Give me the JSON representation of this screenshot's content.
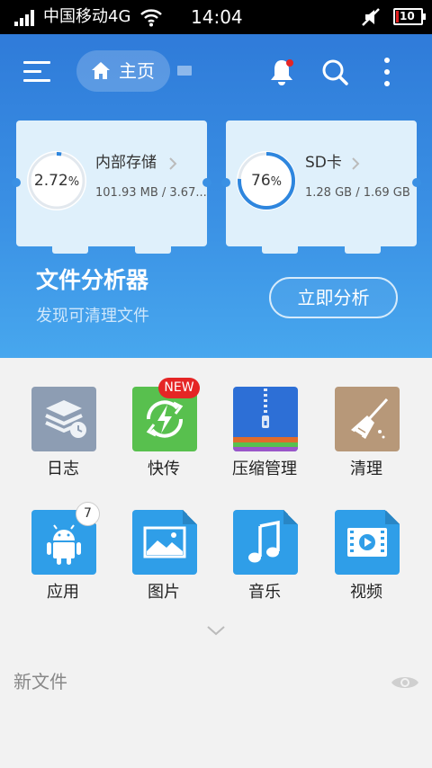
{
  "status_bar": {
    "carrier": "中国移动4G",
    "time": "14:04",
    "battery": "10"
  },
  "header": {
    "home_label": "主页",
    "internal_storage": {
      "percent_value": "2.72",
      "percent_sign": "%",
      "fraction": 0.0272,
      "name": "内部存储",
      "usage": "101.93 MB / 3.67..."
    },
    "sd_card": {
      "percent_value": "76",
      "percent_sign": "%",
      "fraction": 0.76,
      "name": "SD卡",
      "usage": "1.28 GB / 1.69 GB"
    },
    "analyzer_title": "文件分析器",
    "analyzer_subtitle": "发现可清理文件",
    "analyze_button": "立即分析"
  },
  "grid": {
    "items": [
      {
        "label": "日志",
        "icon": "log-icon"
      },
      {
        "label": "快传",
        "icon": "quick-transfer-icon",
        "badge": "NEW"
      },
      {
        "label": "压缩管理",
        "icon": "archive-icon"
      },
      {
        "label": "清理",
        "icon": "broom-icon"
      },
      {
        "label": "应用",
        "icon": "android-icon",
        "badge": "7"
      },
      {
        "label": "图片",
        "icon": "image-icon"
      },
      {
        "label": "音乐",
        "icon": "music-icon"
      },
      {
        "label": "视频",
        "icon": "video-icon"
      }
    ]
  },
  "new_files": {
    "label": "新文件"
  },
  "colors": {
    "header_blue": "#2f7bd9",
    "badge_red": "#e52525",
    "log_tile": "#8d9db3",
    "transfer_tile": "#58c04e",
    "archive_tile": "#2d6fd6",
    "clean_tile": "#b79879",
    "media_tile": "#2f9ee8"
  }
}
